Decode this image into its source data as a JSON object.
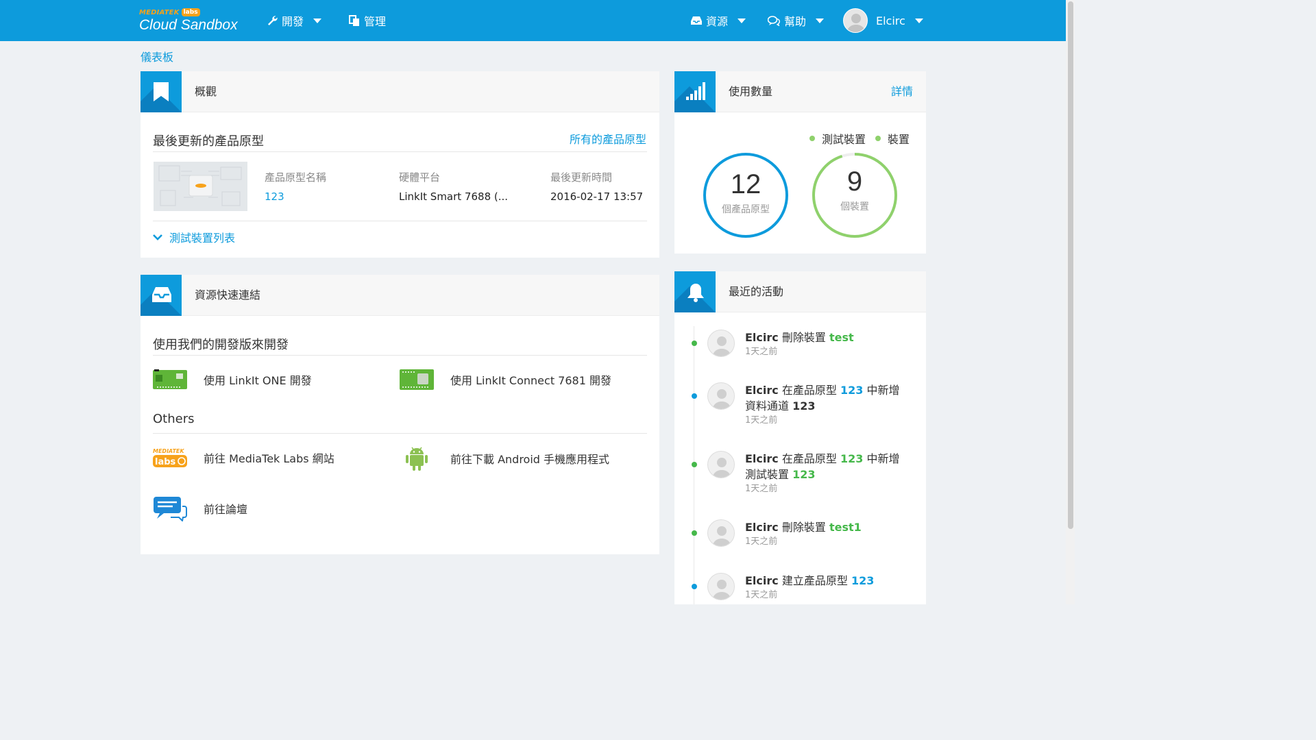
{
  "header": {
    "logo_brand": "MEDIATEK",
    "logo_badge": "labs",
    "logo_title": "Cloud Sandbox",
    "nav_develop": "開發",
    "nav_manage": "管理",
    "nav_resources": "資源",
    "nav_help": "幫助",
    "user_name": "Elcirc"
  },
  "breadcrumb": "儀表板",
  "overview": {
    "title": "概觀",
    "section_title": "最後更新的產品原型",
    "all_link": "所有的產品原型",
    "columns": [
      "產品原型名稱",
      "硬體平台",
      "最後更新時間"
    ],
    "prototype": {
      "name": "123",
      "platform": "LinkIt Smart 7688 (...",
      "updated": "2016-02-17 13:57"
    },
    "test_devices_toggle": "測試裝置列表"
  },
  "resources": {
    "title": "資源快速連結",
    "section_dev": "使用我們的開發版來開發",
    "section_others": "Others",
    "links": {
      "linkit_one": "使用 LinkIt ONE 開發",
      "linkit_connect": "使用 LinkIt Connect 7681 開發",
      "mediatek_labs": "前往 MediaTek Labs 網站",
      "android": "前往下載 Android 手機應用程式",
      "forum": "前往論壇"
    }
  },
  "usage": {
    "title": "使用數量",
    "detail_link": "詳情",
    "legend_test_devices": "測試裝置",
    "legend_devices": "裝置",
    "prototypes_count": "12",
    "prototypes_label": "個產品原型",
    "devices_count": "9",
    "devices_label": "個裝置",
    "devices_ring_fraction": 0.95
  },
  "activity": {
    "title": "最近的活動",
    "items": [
      {
        "user": "Elcirc",
        "pre": " 刪除裝置 ",
        "target": "test",
        "mid": "",
        "target2": "",
        "time": "1天之前",
        "color": "#45b84a"
      },
      {
        "user": "Elcirc",
        "pre": " 在產品原型 ",
        "target": "123",
        "mid": " 中新增資料通道 ",
        "target2": "123",
        "time": "1天之前",
        "color": "#0d9bdc"
      },
      {
        "user": "Elcirc",
        "pre": " 在產品原型 ",
        "target": "123",
        "mid": " 中新增測試裝置 ",
        "target2": "123",
        "time": "1天之前",
        "color": "#45b84a"
      },
      {
        "user": "Elcirc",
        "pre": " 刪除裝置 ",
        "target": "test1",
        "mid": "",
        "target2": "",
        "time": "1天之前",
        "color": "#45b84a"
      },
      {
        "user": "Elcirc",
        "pre": " 建立產品原型 ",
        "target": "123",
        "mid": "",
        "target2": "",
        "time": "1天之前",
        "color": "#0d9bdc"
      }
    ]
  },
  "colors": {
    "brand": "#0d9bdc",
    "green": "#8fd16c",
    "orange": "#f7a21b"
  }
}
